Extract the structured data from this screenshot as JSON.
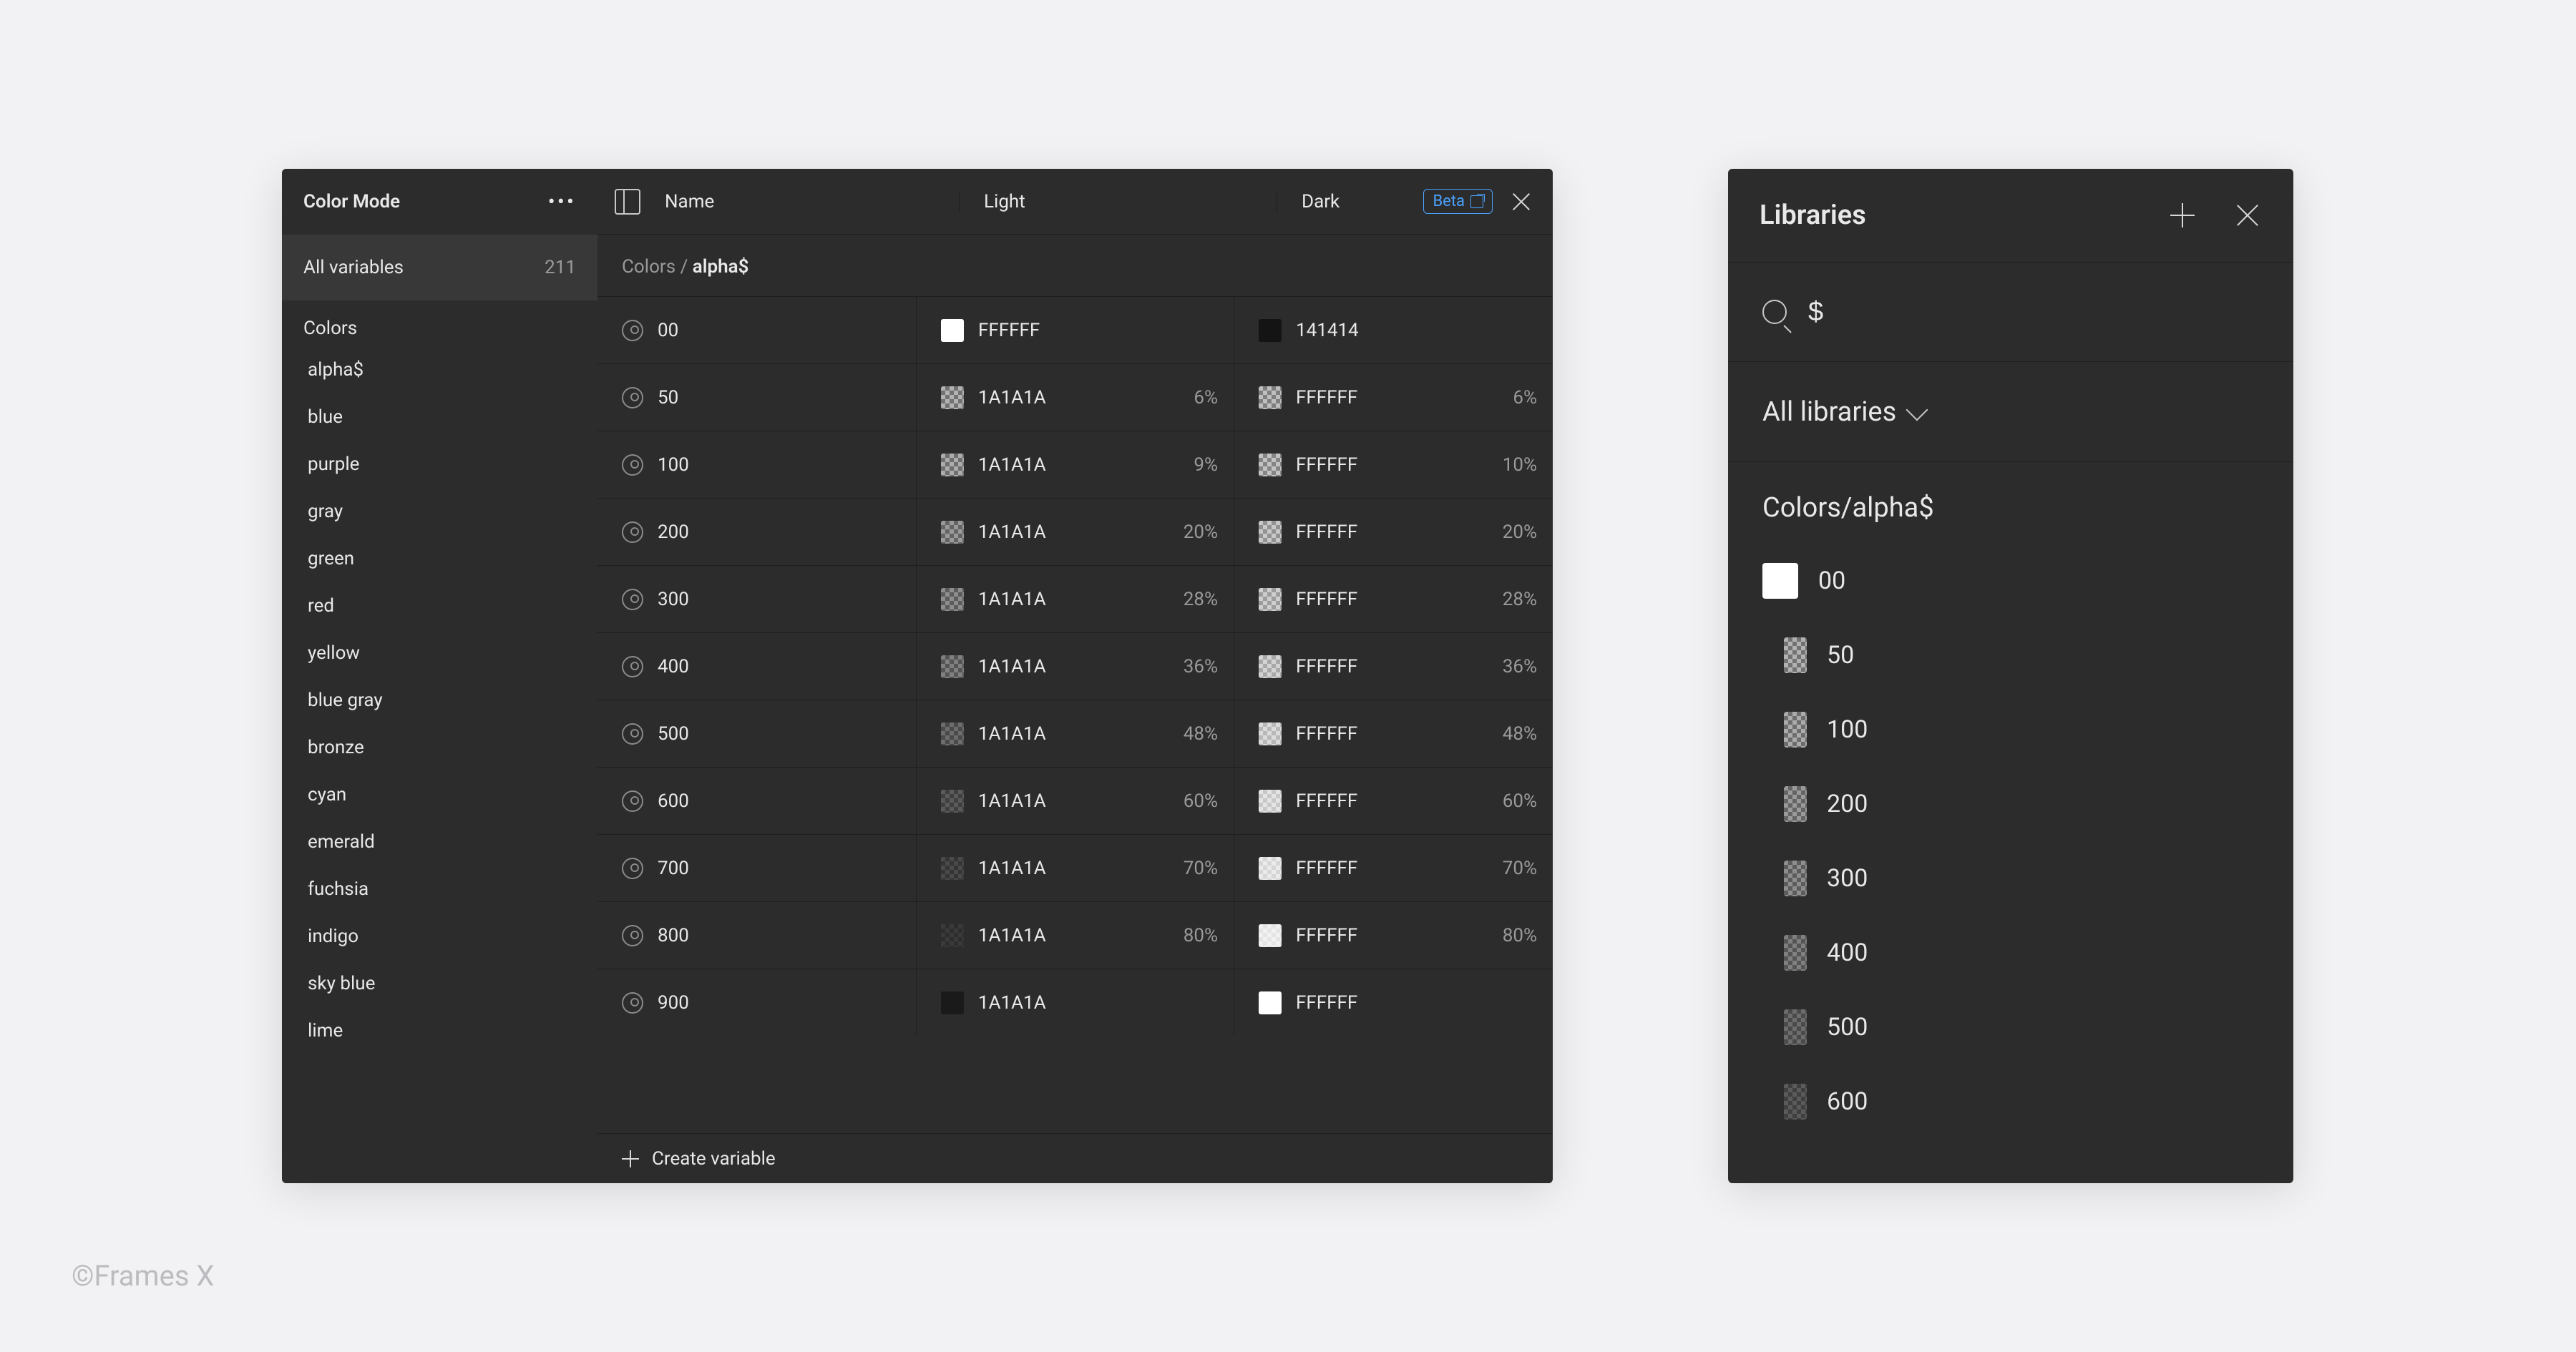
{
  "vars_panel": {
    "title": "Color Mode",
    "all_variables_label": "All variables",
    "all_variables_count": "211",
    "group_label": "Colors",
    "color_groups": [
      "alpha$",
      "blue",
      "purple",
      "gray",
      "green",
      "red",
      "yellow",
      "blue gray",
      "bronze",
      "cyan",
      "emerald",
      "fuchsia",
      "indigo",
      "sky blue",
      "lime"
    ],
    "beta_label": "Beta",
    "col_name": "Name",
    "col_light": "Light",
    "col_dark": "Dark",
    "breadcrumb_prefix": "Colors / ",
    "breadcrumb_strong": "alpha$",
    "rows": [
      {
        "name": "00",
        "light_hex": "FFFFFF",
        "light_pct": "",
        "light_alpha": 1.0,
        "dark_hex": "141414",
        "dark_pct": "",
        "dark_alpha": 1.0,
        "light_bg": "#ffffff",
        "dark_bg": "#141414",
        "use_checker": false
      },
      {
        "name": "50",
        "light_hex": "1A1A1A",
        "light_pct": "6%",
        "light_alpha": 0.06,
        "dark_hex": "FFFFFF",
        "dark_pct": "6%",
        "dark_alpha": 0.06,
        "use_checker": true
      },
      {
        "name": "100",
        "light_hex": "1A1A1A",
        "light_pct": "9%",
        "light_alpha": 0.09,
        "dark_hex": "FFFFFF",
        "dark_pct": "10%",
        "dark_alpha": 0.1,
        "use_checker": true
      },
      {
        "name": "200",
        "light_hex": "1A1A1A",
        "light_pct": "20%",
        "light_alpha": 0.2,
        "dark_hex": "FFFFFF",
        "dark_pct": "20%",
        "dark_alpha": 0.2,
        "use_checker": true
      },
      {
        "name": "300",
        "light_hex": "1A1A1A",
        "light_pct": "28%",
        "light_alpha": 0.28,
        "dark_hex": "FFFFFF",
        "dark_pct": "28%",
        "dark_alpha": 0.28,
        "use_checker": true
      },
      {
        "name": "400",
        "light_hex": "1A1A1A",
        "light_pct": "36%",
        "light_alpha": 0.36,
        "dark_hex": "FFFFFF",
        "dark_pct": "36%",
        "dark_alpha": 0.36,
        "use_checker": true
      },
      {
        "name": "500",
        "light_hex": "1A1A1A",
        "light_pct": "48%",
        "light_alpha": 0.48,
        "dark_hex": "FFFFFF",
        "dark_pct": "48%",
        "dark_alpha": 0.48,
        "use_checker": true
      },
      {
        "name": "600",
        "light_hex": "1A1A1A",
        "light_pct": "60%",
        "light_alpha": 0.6,
        "dark_hex": "FFFFFF",
        "dark_pct": "60%",
        "dark_alpha": 0.6,
        "use_checker": true
      },
      {
        "name": "700",
        "light_hex": "1A1A1A",
        "light_pct": "70%",
        "light_alpha": 0.7,
        "dark_hex": "FFFFFF",
        "dark_pct": "70%",
        "dark_alpha": 0.7,
        "use_checker": true
      },
      {
        "name": "800",
        "light_hex": "1A1A1A",
        "light_pct": "80%",
        "light_alpha": 0.8,
        "dark_hex": "FFFFFF",
        "dark_pct": "80%",
        "dark_alpha": 0.8,
        "use_checker": true
      },
      {
        "name": "900",
        "light_hex": "1A1A1A",
        "light_pct": "",
        "light_alpha": 1.0,
        "dark_hex": "FFFFFF",
        "dark_pct": "",
        "dark_alpha": 1.0,
        "use_checker": false,
        "light_bg": "#1A1A1A",
        "dark_bg": "#ffffff"
      }
    ],
    "create_variable_label": "Create variable"
  },
  "libs_panel": {
    "title": "Libraries",
    "search_value": "$",
    "dropdown_label": "All libraries",
    "section_title": "Colors/alpha$",
    "items": [
      {
        "label": "00",
        "alpha": 1.0,
        "shifted": false,
        "checker": false,
        "bg": "#ffffff"
      },
      {
        "label": "50",
        "alpha": 0.06,
        "shifted": true,
        "checker": true
      },
      {
        "label": "100",
        "alpha": 0.1,
        "shifted": true,
        "checker": true
      },
      {
        "label": "200",
        "alpha": 0.2,
        "shifted": true,
        "checker": true
      },
      {
        "label": "300",
        "alpha": 0.28,
        "shifted": true,
        "checker": true
      },
      {
        "label": "400",
        "alpha": 0.36,
        "shifted": true,
        "checker": true
      },
      {
        "label": "500",
        "alpha": 0.48,
        "shifted": true,
        "checker": true
      },
      {
        "label": "600",
        "alpha": 0.6,
        "shifted": true,
        "checker": true
      }
    ]
  },
  "footer_credit": "©Frames X"
}
